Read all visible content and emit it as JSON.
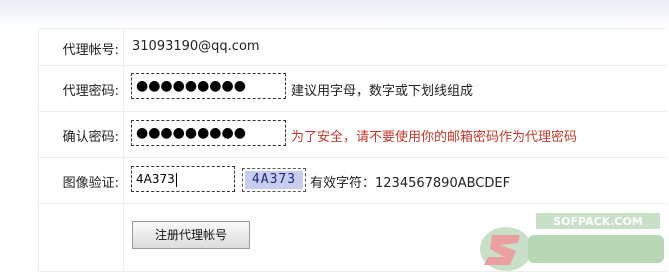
{
  "form": {
    "account_label": "代理帐号:",
    "account_value": "31093190@qq.com",
    "password_label": "代理密码:",
    "password_value": "●●●●●●●●●",
    "password_hint": "建议用字母，数字或下划线组成",
    "confirm_label": "确认密码:",
    "confirm_value": "●●●●●●●●●",
    "confirm_hint": "为了安全，请不要使用你的邮箱密码作为代理密码",
    "captcha_label": "图像验证:",
    "captcha_input_value": "4A373",
    "captcha_image_text": "4A373",
    "captcha_valid_chars": "有效字符：1234567890ABCDEF",
    "submit_label": "注册代理帐号"
  },
  "watermark": {
    "text": "SOFPACK.COM"
  },
  "colors": {
    "hint_red": "#c0392b",
    "captcha_bg": "#c8cdf0"
  }
}
